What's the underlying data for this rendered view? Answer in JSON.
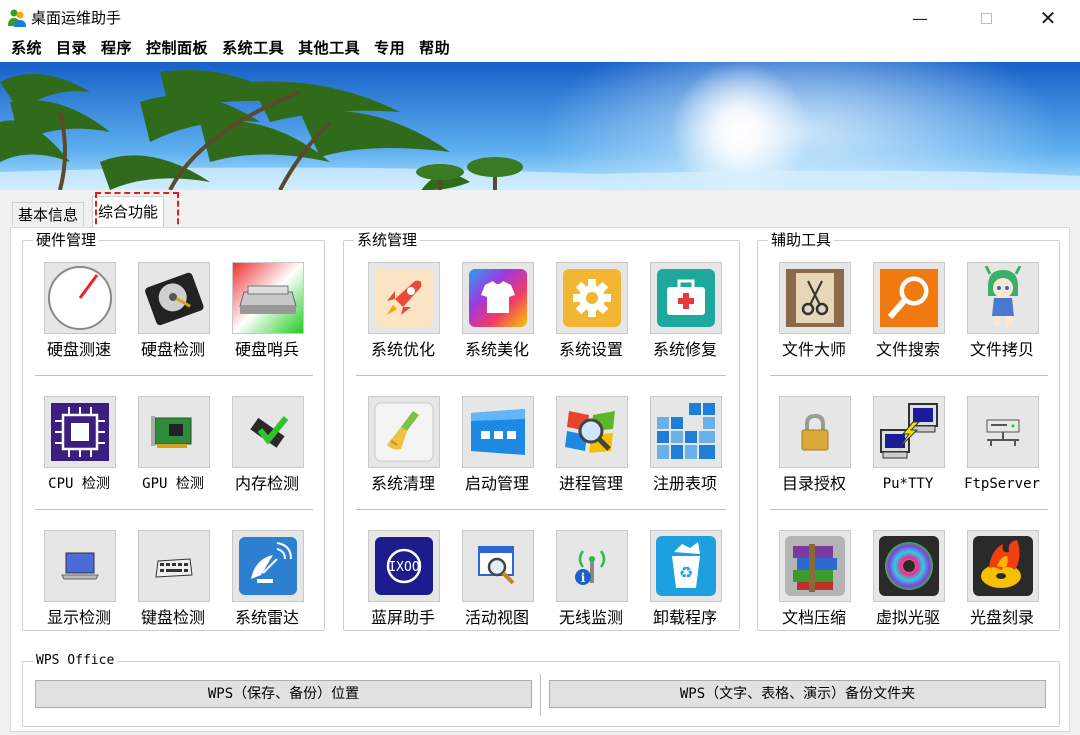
{
  "window": {
    "title": "桌面运维助手",
    "minimize_icon": "minimize-icon",
    "maximize_icon": "maximize-icon",
    "close_icon": "close-icon"
  },
  "menubar": [
    "系统",
    "目录",
    "程序",
    "控制面板",
    "系统工具",
    "其他工具",
    "专用",
    "帮助"
  ],
  "tabs": {
    "basic": "基本信息",
    "func": "综合功能"
  },
  "groups": {
    "hardware": {
      "title": "硬件管理",
      "rows": [
        [
          "硬盘测速",
          "硬盘检测",
          "硬盘哨兵"
        ],
        [
          "CPU 检测",
          "GPU 检测",
          "内存检测"
        ],
        [
          "显示检测",
          "键盘检测",
          "系统雷达"
        ]
      ]
    },
    "system": {
      "title": "系统管理",
      "rows": [
        [
          "系统优化",
          "系统美化",
          "系统设置",
          "系统修复"
        ],
        [
          "系统清理",
          "启动管理",
          "进程管理",
          "注册表项"
        ],
        [
          "蓝屏助手",
          "活动视图",
          "无线监测",
          "卸载程序"
        ]
      ]
    },
    "aux": {
      "title": "辅助工具",
      "rows": [
        [
          "文件大师",
          "文件搜索",
          "文件拷贝"
        ],
        [
          "目录授权",
          "Pu*TTY",
          "FtpServer"
        ],
        [
          "文档压缩",
          "虚拟光驱",
          "光盘刻录"
        ]
      ]
    },
    "wps": {
      "title": "WPS Office",
      "btn1": "WPS（保存、备份）位置",
      "btn2": "WPS（文字、表格、演示）备份文件夹"
    }
  },
  "colors": {
    "accent_highlight": "#e02020",
    "sky_top": "#1e6fd8",
    "sky_bottom": "#9fd6ff"
  }
}
